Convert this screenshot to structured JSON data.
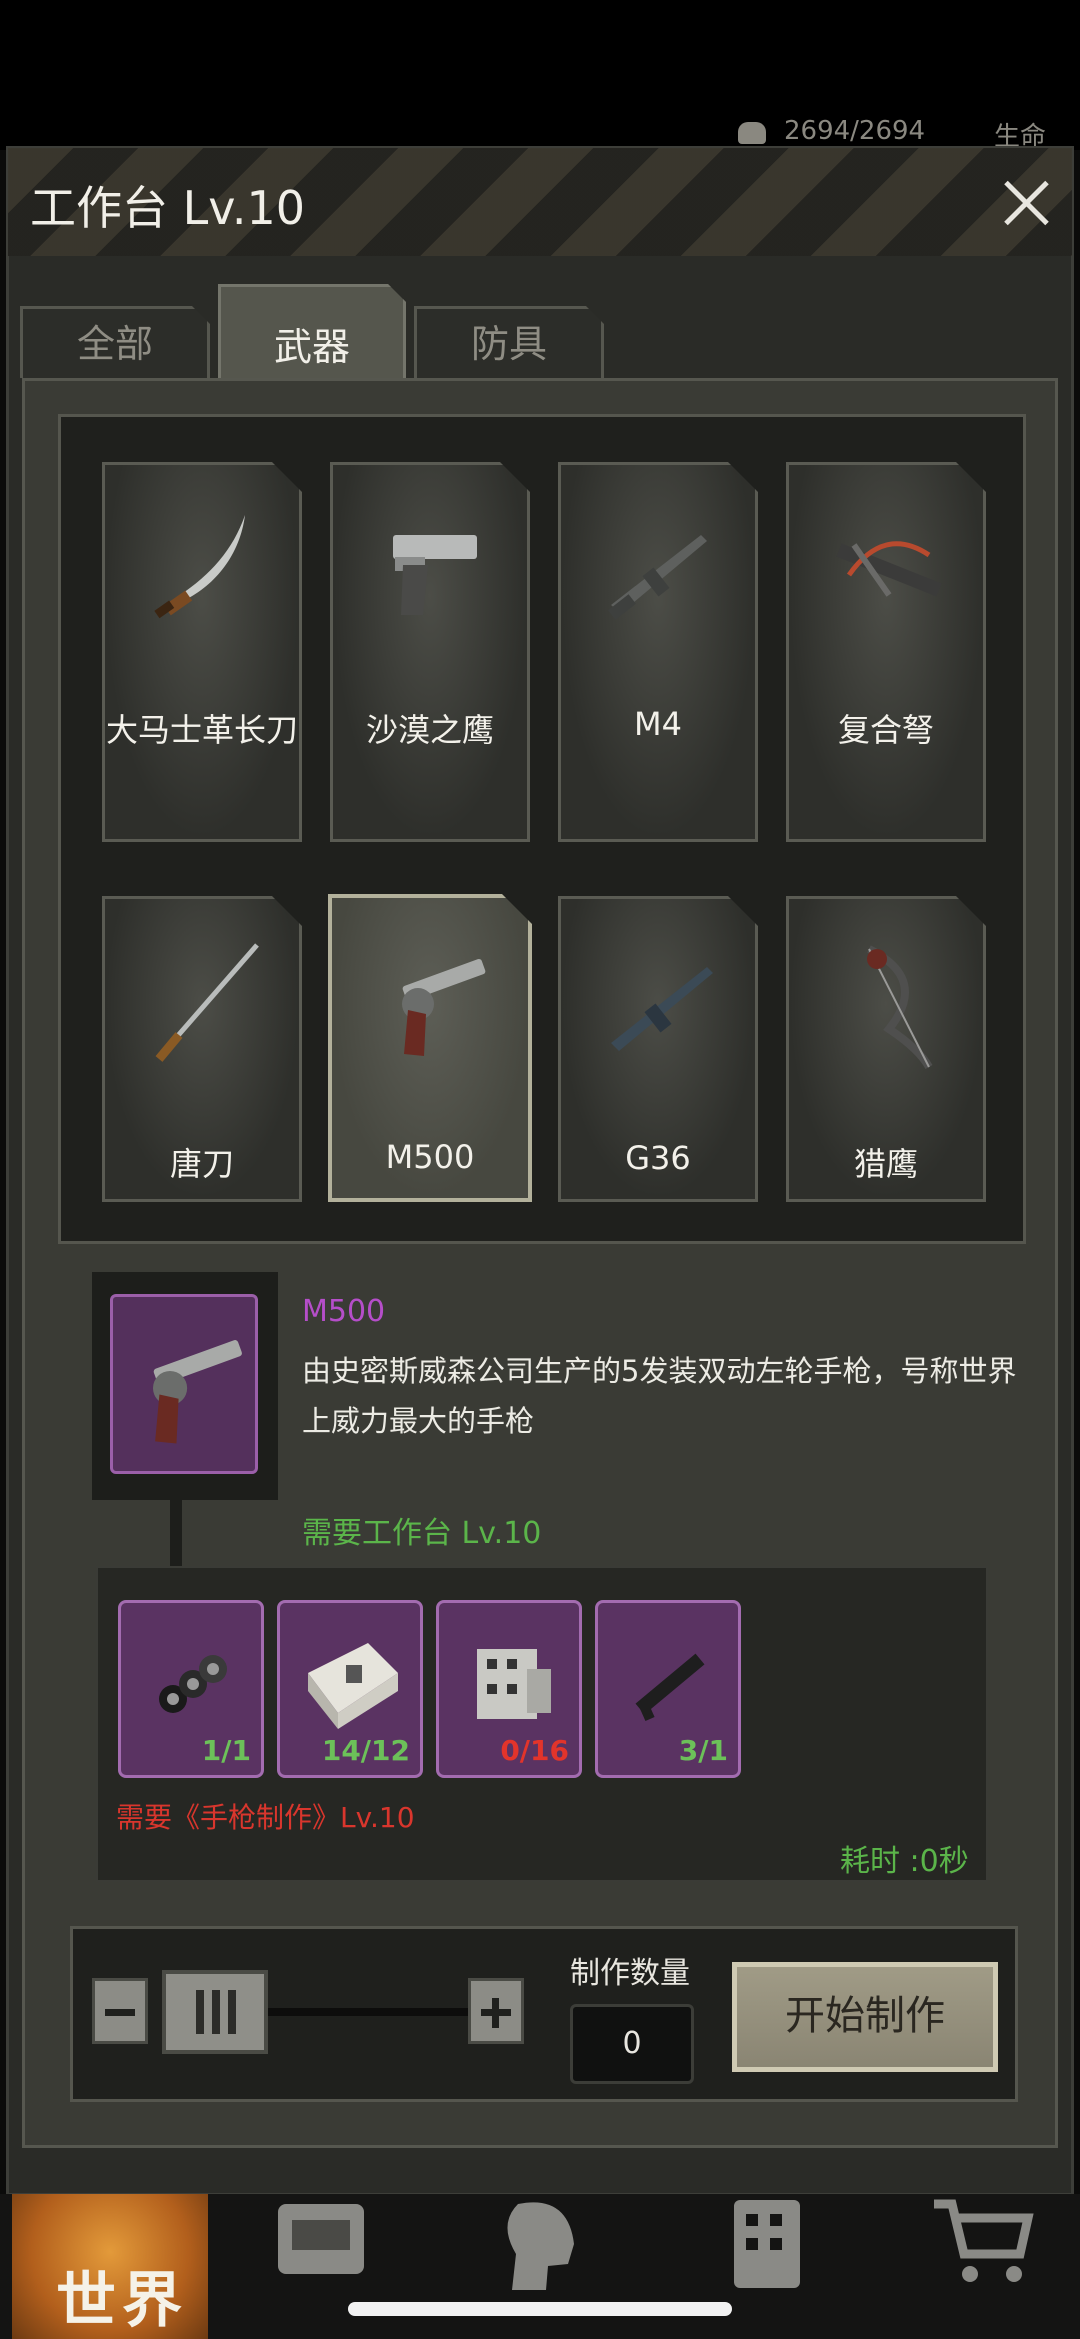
{
  "status": {
    "hp_text": "2694/2694",
    "life_label": "生命"
  },
  "window": {
    "title": "工作台 Lv.10"
  },
  "tabs": [
    {
      "label": "全部"
    },
    {
      "label": "武器"
    },
    {
      "label": "防具"
    }
  ],
  "tabs_active_index": 1,
  "weapons": [
    {
      "name": "大马士革长刀",
      "icon": "scimitar-icon"
    },
    {
      "name": "沙漠之鹰",
      "icon": "pistol-icon"
    },
    {
      "name": "M4",
      "icon": "rifle-icon"
    },
    {
      "name": "复合弩",
      "icon": "crossbow-icon"
    },
    {
      "name": "唐刀",
      "icon": "katana-icon"
    },
    {
      "name": "M500",
      "icon": "revolver-icon"
    },
    {
      "name": "G36",
      "icon": "rifle-icon"
    },
    {
      "name": "猎鹰",
      "icon": "compound-bow-icon"
    }
  ],
  "selected_index": 5,
  "detail": {
    "name": "M500",
    "description": "由史密斯威森公司生产的5发装双动左轮手枪，号称世界上威力最大的手枪",
    "requirement_bench": "需要工作台 Lv.10",
    "materials": [
      {
        "icon": "pipes-icon",
        "count": "1/1",
        "ok": true
      },
      {
        "icon": "metal-block-icon",
        "count": "14/12",
        "ok": true
      },
      {
        "icon": "mechanical-part-icon",
        "count": "0/16",
        "ok": false
      },
      {
        "icon": "gun-barrel-icon",
        "count": "3/1",
        "ok": true
      }
    ],
    "requirement_skill": "需要《手枪制作》Lv.10",
    "time": "耗时 :0秒"
  },
  "controls": {
    "quantity_label": "制作数量",
    "quantity_value": "0",
    "start_label": "开始制作"
  },
  "nav": {
    "world_label": "世界"
  },
  "colors": {
    "material_purple": "#5a3362",
    "ok_green": "#6cc159",
    "missing_red": "#e2342b"
  }
}
